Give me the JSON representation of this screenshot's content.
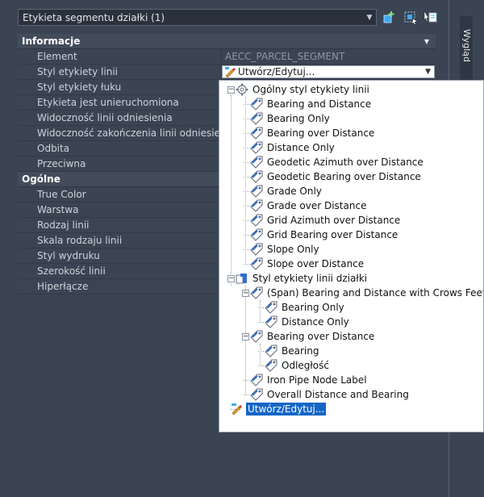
{
  "header": {
    "object_select": "Etykieta segmentu działki (1)",
    "tools": [
      "add-selection-icon",
      "quick-select-icon",
      "toggle-pickadd-icon"
    ]
  },
  "sidetab": {
    "label": "Wygląd"
  },
  "sections": {
    "informacje": {
      "title": "Informacje",
      "rows": [
        {
          "name": "Element",
          "value": "AECC_PARCEL_SEGMENT"
        },
        {
          "name": "Styl etykiety linii",
          "value": "Utwórz/Edytuj..."
        },
        {
          "name": "Styl etykiety łuku",
          "value": ""
        },
        {
          "name": "Etykieta jest unieruchomiona",
          "value": ""
        },
        {
          "name": "Widoczność linii odniesienia",
          "value": ""
        },
        {
          "name": "Widoczność zakończenia linii odniesienia",
          "value": ""
        },
        {
          "name": "Odbita",
          "value": ""
        },
        {
          "name": "Przeciwna",
          "value": ""
        }
      ]
    },
    "ogolne": {
      "title": "Ogólne",
      "rows": [
        {
          "name": "True Color",
          "value": ""
        },
        {
          "name": "Warstwa",
          "value": ""
        },
        {
          "name": "Rodzaj linii",
          "value": ""
        },
        {
          "name": "Skala rodzaju linii",
          "value": ""
        },
        {
          "name": "Styl wydruku",
          "value": ""
        },
        {
          "name": "Szerokość linii",
          "value": ""
        },
        {
          "name": "Hiperłącze",
          "value": ""
        }
      ]
    }
  },
  "dropdown": {
    "general_group": {
      "label": "Ogólny styl etykiety linii",
      "items": [
        "Bearing and Distance",
        "Bearing Only",
        "Bearing over Distance",
        "Distance Only",
        "Geodetic Azimuth over Distance",
        "Geodetic Bearing over Distance",
        "Grade Only",
        "Grade over Distance",
        "Grid Azimuth over Distance",
        "Grid Bearing over Distance",
        "Slope Only",
        "Slope over Distance"
      ]
    },
    "parcel_group": {
      "label": "Styl etykiety linii działki",
      "span": {
        "label": "(Span)  Bearing and Distance with Crows Feet",
        "children": [
          "Bearing Only",
          "Distance Only"
        ]
      },
      "bod": {
        "label": "Bearing over Distance",
        "children": [
          "Bearing",
          "Odległość"
        ]
      },
      "items": [
        "Iron Pipe Node Label",
        "Overall Distance and Bearing"
      ]
    },
    "create_edit": "Utwórz/Edytuj..."
  }
}
